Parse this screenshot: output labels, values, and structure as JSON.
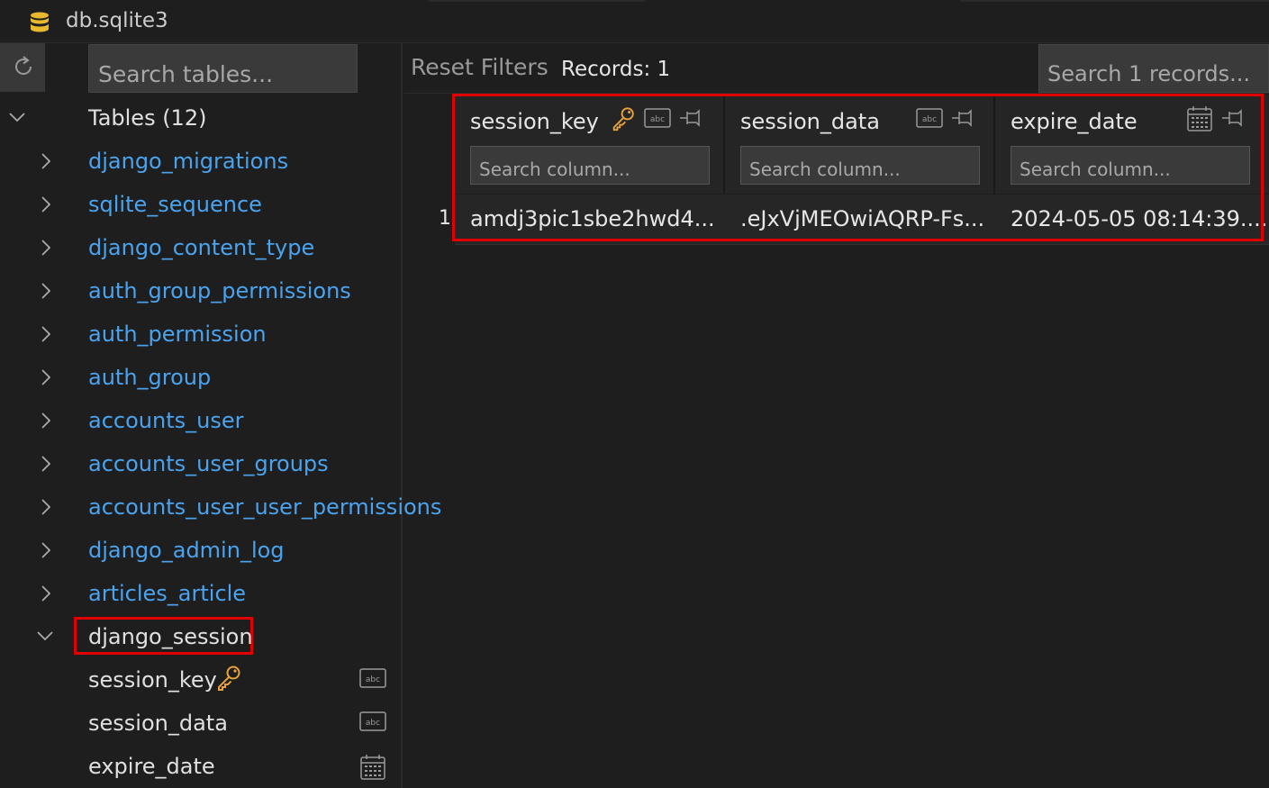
{
  "window": {
    "title": "db.sqlite3"
  },
  "sidebar": {
    "search_placeholder": "Search tables...",
    "tables_header": "Tables (12)",
    "tables": [
      "django_migrations",
      "sqlite_sequence",
      "django_content_type",
      "auth_group_permissions",
      "auth_permission",
      "auth_group",
      "accounts_user",
      "accounts_user_groups",
      "accounts_user_user_permissions",
      "django_admin_log",
      "articles_article"
    ],
    "expanded_table": "django_session",
    "columns": [
      {
        "name": "session_key",
        "type_icon": "text-abc-icon",
        "primary_key": true
      },
      {
        "name": "session_data",
        "type_icon": "text-abc-icon",
        "primary_key": false
      },
      {
        "name": "expire_date",
        "type_icon": "calendar-icon",
        "primary_key": false
      }
    ]
  },
  "toolbar": {
    "reset_filters": "Reset Filters",
    "records_label": "Records: 1",
    "search_placeholder": "Search 1 records..."
  },
  "grid": {
    "column_search_placeholder": "Search column...",
    "columns": [
      {
        "name": "session_key",
        "icons": [
          "key-icon",
          "text-abc-icon",
          "pin-icon"
        ]
      },
      {
        "name": "session_data",
        "icons": [
          "text-abc-icon",
          "pin-icon"
        ]
      },
      {
        "name": "expire_date",
        "icons": [
          "calendar-icon",
          "pin-icon"
        ]
      }
    ],
    "rows": [
      {
        "index": "1",
        "cells": [
          "amdj3pic1sbe2hwd4...",
          ".eJxVjMEOwiAQRP-Fs...",
          "2024-05-05 08:14:39...."
        ]
      }
    ]
  },
  "colors": {
    "link": "#4aa3ef",
    "key": "#e8a33a",
    "highlight": "#e00000"
  }
}
